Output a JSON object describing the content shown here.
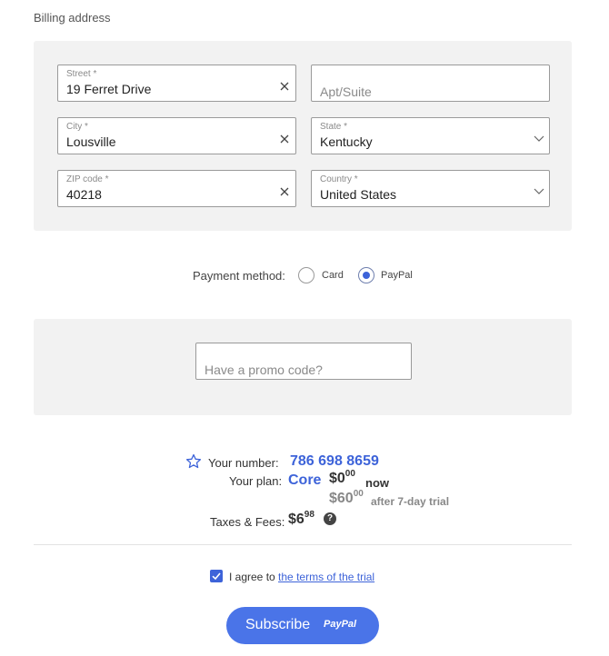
{
  "billing": {
    "title": "Billing address",
    "street": {
      "label": "Street *",
      "value": "19 Ferret Drive"
    },
    "apt": {
      "placeholder": "Apt/Suite"
    },
    "city": {
      "label": "City *",
      "value": "Lousville"
    },
    "state": {
      "label": "State *",
      "value": "Kentucky"
    },
    "zip": {
      "label": "ZIP code *",
      "value": "40218"
    },
    "country": {
      "label": "Country *",
      "value": "United States"
    }
  },
  "payment": {
    "label": "Payment method:",
    "options": [
      {
        "label": "Card",
        "selected": false
      },
      {
        "label": "PayPal",
        "selected": true
      }
    ]
  },
  "promo": {
    "placeholder": "Have a promo code?"
  },
  "summary": {
    "number_label": "Your number:",
    "number_value": "786 698 8659",
    "plan_label": "Your plan:",
    "plan_value": "Core",
    "price_now_main": "$0",
    "price_now_cents": "00",
    "price_now_label": "now",
    "price_later_main": "$60",
    "price_later_cents": "00",
    "price_later_label": "after 7-day trial",
    "fees_label": "Taxes & Fees:",
    "fees_main": "$6",
    "fees_cents": "98",
    "help_glyph": "?"
  },
  "agreement": {
    "checked": true,
    "text": "I agree to",
    "link": "the terms of the trial"
  },
  "subscribe": {
    "label": "Subscribe",
    "logo_text": "PayPal"
  },
  "colors": {
    "accent": "#3d63d9",
    "button": "#4a74e8",
    "panel": "#f2f2f2"
  }
}
